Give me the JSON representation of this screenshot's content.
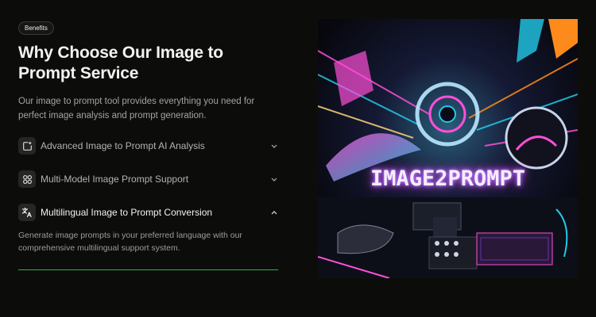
{
  "badge": "Benefits",
  "title": "Why Choose Our Image to Prompt Service",
  "subtitle": "Our image to prompt tool provides everything you need for perfect image analysis and prompt generation.",
  "accordion": {
    "items": [
      {
        "label": "Advanced Image to Prompt AI Analysis",
        "icon": "image-plus-icon",
        "open": false
      },
      {
        "label": "Multi-Model Image Prompt Support",
        "icon": "grid-circles-icon",
        "open": false
      },
      {
        "label": "Multilingual Image to Prompt Conversion",
        "icon": "translate-icon",
        "open": true
      }
    ],
    "open_description": "Generate image prompts in your preferred language with our comprehensive multilingual support system."
  },
  "artwork": {
    "text": "IMAGE2PROMPT",
    "accent_colors": [
      "#ff4fd8",
      "#22c9e8",
      "#ff8a1c",
      "#7a3cff"
    ]
  },
  "colors": {
    "background": "#0c0d0b",
    "divider_active": "#3cae3c"
  }
}
